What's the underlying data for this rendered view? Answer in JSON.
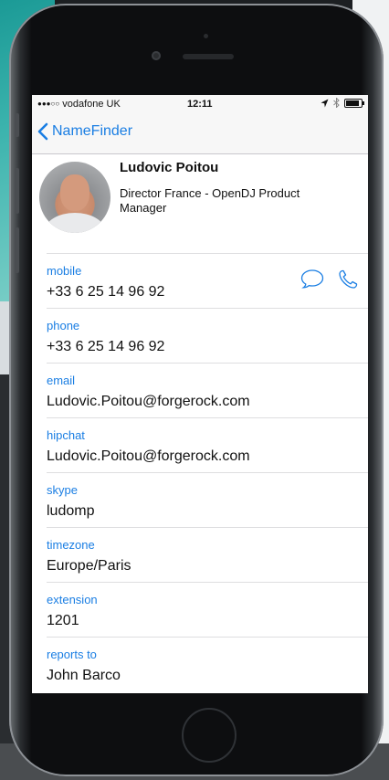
{
  "status_bar": {
    "signal": "●●●○○",
    "carrier": "vodafone UK",
    "time": "12:11"
  },
  "nav": {
    "back_label": "NameFinder"
  },
  "contact": {
    "name": "Ludovic Poitou",
    "title": "Director France - OpenDJ Product Manager"
  },
  "fields": [
    {
      "label": "mobile",
      "value": "+33 6 25 14 96 92"
    },
    {
      "label": "phone",
      "value": "+33 6 25 14 96 92"
    },
    {
      "label": "email",
      "value": "Ludovic.Poitou@forgerock.com"
    },
    {
      "label": "hipchat",
      "value": "Ludovic.Poitou@forgerock.com"
    },
    {
      "label": "skype",
      "value": "ludomp"
    },
    {
      "label": "timezone",
      "value": "Europe/Paris"
    },
    {
      "label": "extension",
      "value": "1201"
    },
    {
      "label": "reports to",
      "value": "John Barco"
    }
  ],
  "colors": {
    "accent": "#1a7ee3",
    "separator": "#dedee0"
  },
  "icons": {
    "back": "chevron-left-icon",
    "message": "speech-bubble-icon",
    "call": "phone-icon"
  }
}
